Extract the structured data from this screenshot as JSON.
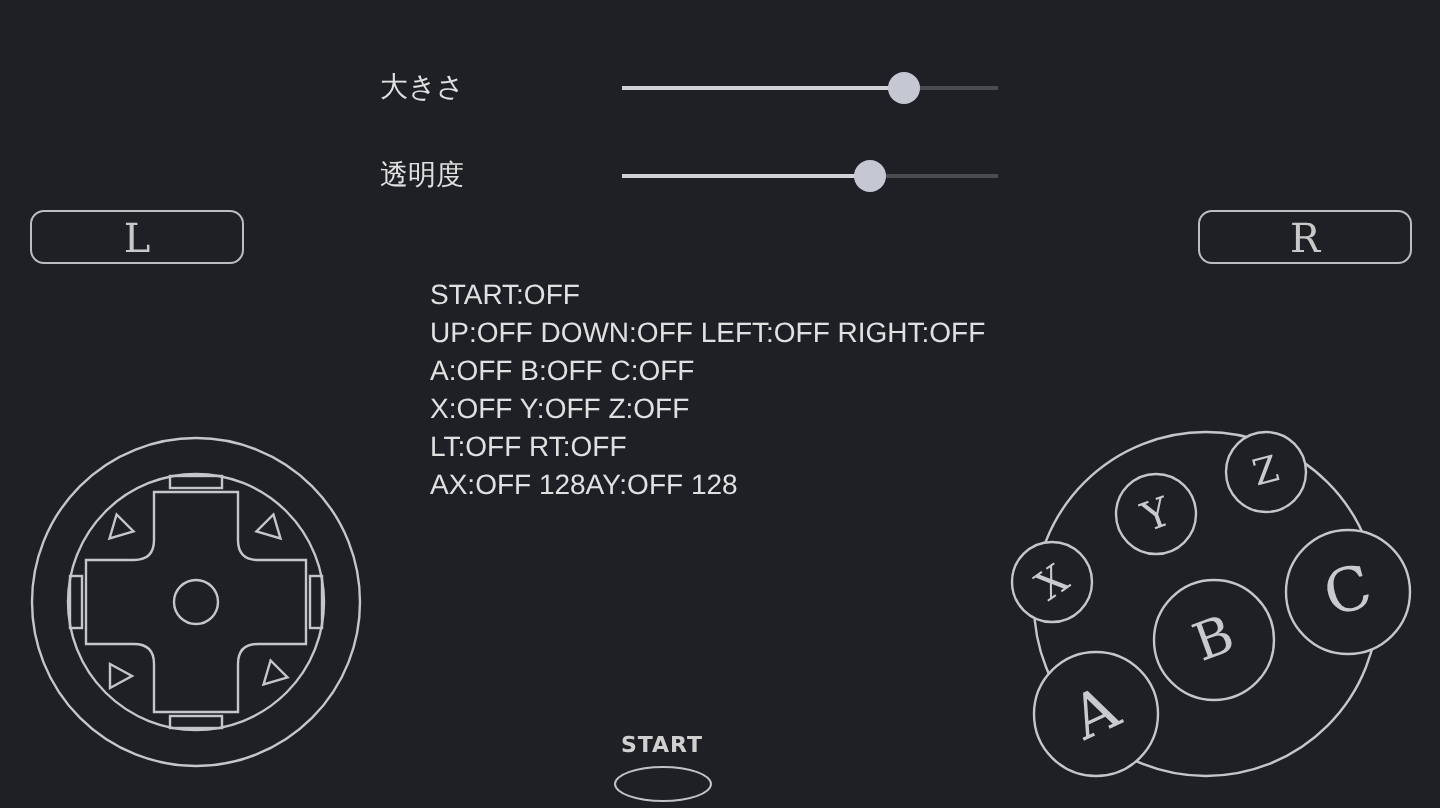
{
  "sliders": [
    {
      "label": "大きさ",
      "level": 0.75
    },
    {
      "label": "透明度",
      "level": 0.66
    }
  ],
  "shoulder_buttons": [
    {
      "label": "L"
    },
    {
      "label": "R"
    }
  ],
  "status_lines": [
    "START:OFF",
    "UP:OFF DOWN:OFF LEFT:OFF RIGHT:OFF",
    "A:OFF B:OFF C:OFF",
    "X:OFF Y:OFF Z:OFF",
    "LT:OFF RT:OFF",
    "AX:OFF 128AY:OFF 128"
  ],
  "face_buttons": [
    {
      "label": "A"
    },
    {
      "label": "B"
    },
    {
      "label": "C"
    },
    {
      "label": "X"
    },
    {
      "label": "Y"
    },
    {
      "label": "Z"
    }
  ],
  "start_button": {
    "label": "START"
  }
}
